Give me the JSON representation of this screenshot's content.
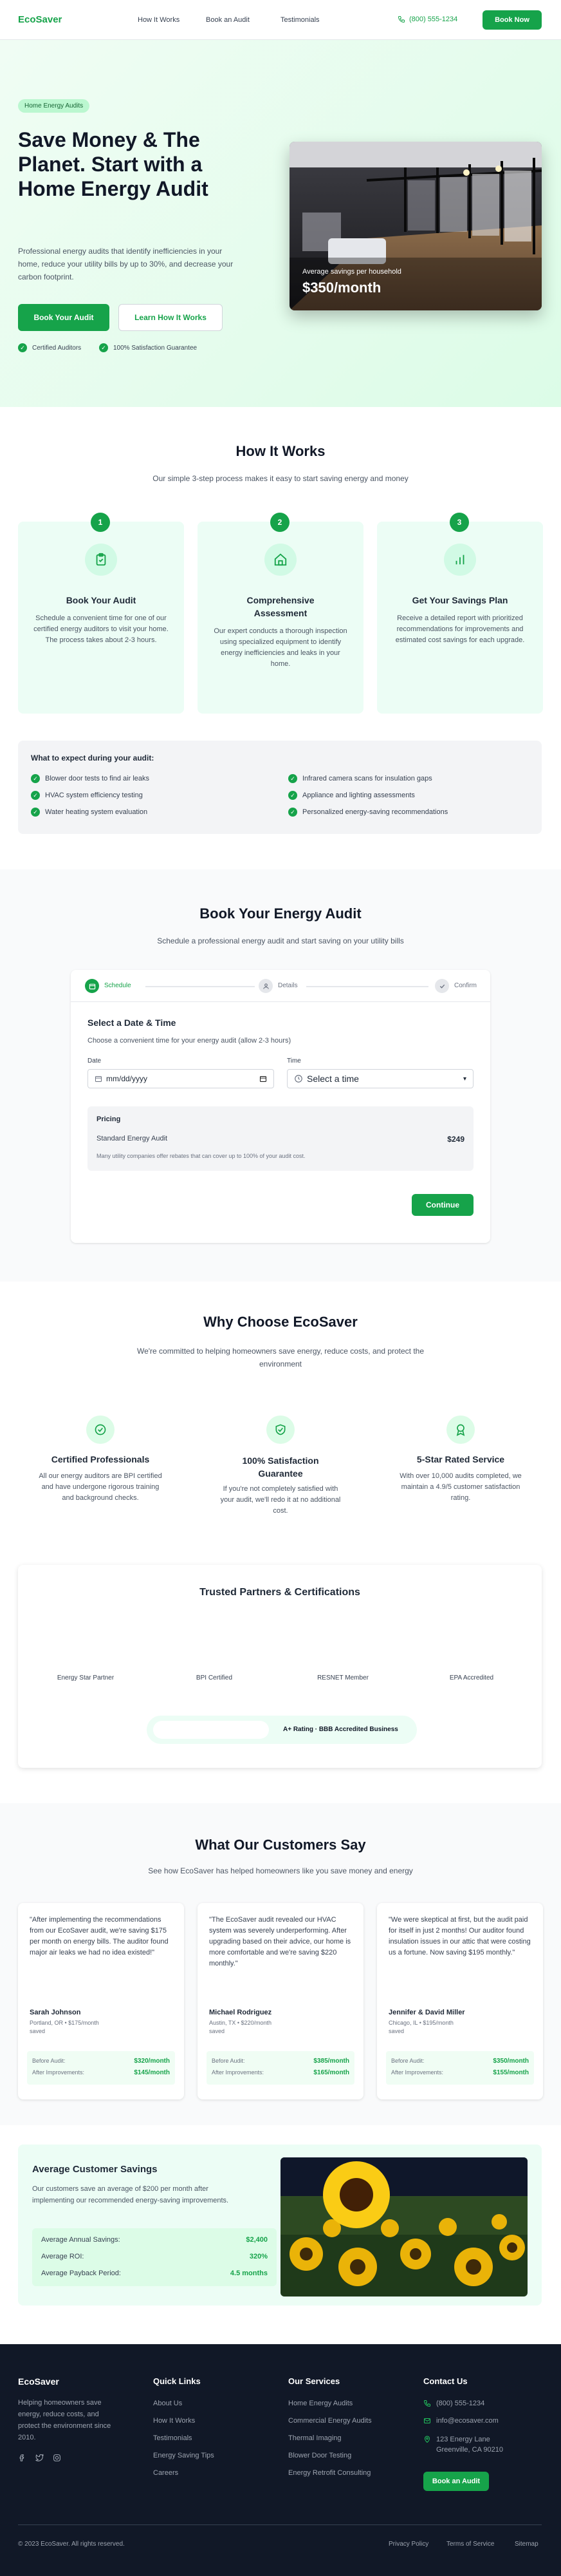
{
  "nav": {
    "logo": "EcoSaver",
    "links": [
      "How It Works",
      "Book an Audit",
      "Testimonials"
    ],
    "phone": "(800) 555-1234",
    "cta": "Book Now"
  },
  "hero": {
    "badge": "Home Energy Audits",
    "title": "Save Money & The Planet. Start with a Home Energy Audit",
    "desc": "Professional energy audits that identify inefficiencies in your home, reduce your utility bills by up to 30%, and decrease your carbon footprint.",
    "btn_primary": "Book Your Audit",
    "btn_secondary": "Learn How It Works",
    "trust": [
      "Certified Auditors",
      "100% Satisfaction Guarantee"
    ],
    "img_caption": "Average savings per household",
    "img_value": "$350/month"
  },
  "how": {
    "title": "How It Works",
    "subtitle": "Our simple 3-step process makes it easy to start saving energy and money",
    "steps": [
      {
        "num": "1",
        "title": "Book Your Audit",
        "desc": "Schedule a convenient time for one of our certified energy auditors to visit your home. The process takes about 2-3 hours.",
        "icon": "clipboard-icon"
      },
      {
        "num": "2",
        "title": "Comprehensive Assessment",
        "desc": "Our expert conducts a thorough inspection using specialized equipment to identify energy inefficiencies and leaks in your home.",
        "icon": "home-icon"
      },
      {
        "num": "3",
        "title": "Get Your Savings Plan",
        "desc": "Receive a detailed report with prioritized recommendations for improvements and estimated cost savings for each upgrade.",
        "icon": "chart-icon"
      }
    ],
    "expect_title": "What to expect during your audit:",
    "expect": [
      "Blower door tests to find air leaks",
      "HVAC system efficiency testing",
      "Water heating system evaluation",
      "Infrared camera scans for insulation gaps",
      "Appliance and lighting assessments",
      "Personalized energy-saving recommendations"
    ]
  },
  "book": {
    "title": "Book Your Energy Audit",
    "subtitle": "Schedule a professional energy audit and start saving on your utility bills",
    "steps": [
      "Schedule",
      "Details",
      "Confirm"
    ],
    "form_title": "Select a Date & Time",
    "form_sub": "Choose a convenient time for your energy audit (allow 2-3 hours)",
    "date_label": "Date",
    "date_placeholder": "mm/dd/yyyy",
    "time_label": "Time",
    "time_value": "Select a time",
    "pricing_title": "Pricing",
    "pricing_item": "Standard Energy Audit",
    "pricing_value": "$249",
    "pricing_note": "Many utility companies offer rebates that can cover up to 100% of your audit cost.",
    "continue": "Continue"
  },
  "why": {
    "title": "Why Choose EcoSaver",
    "subtitle": "We're committed to helping homeowners save energy, reduce costs, and protect the environment",
    "items": [
      {
        "title": "Certified Professionals",
        "desc": "All our energy auditors are BPI certified and have undergone rigorous training and background checks."
      },
      {
        "title": "100% Satisfaction Guarantee",
        "desc": "If you're not completely satisfied with your audit, we'll redo it at no additional cost."
      },
      {
        "title": "5-Star Rated Service",
        "desc": "With over 10,000 audits completed, we maintain a 4.9/5 customer satisfaction rating."
      }
    ],
    "partners_title": "Trusted Partners & Certifications",
    "partners": [
      "Energy Star Partner",
      "BPI Certified",
      "RESNET Member",
      "EPA Accredited"
    ],
    "rating": "A+ Rating · BBB Accredited Business"
  },
  "testimonials": {
    "title": "What Our Customers Say",
    "subtitle": "See how EcoSaver has helped homeowners like you save money and energy",
    "items": [
      {
        "quote": "\"After implementing the recommendations from our EcoSaver audit, we're saving $175 per month on energy bills. The auditor found major air leaks we had no idea existed!\"",
        "name": "Sarah Johnson",
        "loc": "Portland, OR • $175/month saved",
        "before": "$320/month",
        "after": "$145/month"
      },
      {
        "quote": "\"The EcoSaver audit revealed our HVAC system was severely underperforming. After upgrading based on their advice, our home is more comfortable and we're saving $220 monthly.\"",
        "name": "Michael Rodriguez",
        "loc": "Austin, TX • $220/month saved",
        "before": "$385/month",
        "after": "$165/month"
      },
      {
        "quote": "\"We were skeptical at first, but the audit paid for itself in just 2 months! Our auditor found insulation issues in our attic that were costing us a fortune. Now saving $195 monthly.\"",
        "name": "Jennifer & David Miller",
        "loc": "Chicago, IL • $195/month saved",
        "before": "$350/month",
        "after": "$155/month"
      }
    ],
    "before_label": "Before Audit:",
    "after_label": "After Improvements:"
  },
  "savings": {
    "title": "Average Customer Savings",
    "desc": "Our customers save an average of $200 per month after implementing our recommended energy-saving improvements.",
    "rows": [
      {
        "label": "Average Annual Savings:",
        "value": "$2,400"
      },
      {
        "label": "Average ROI:",
        "value": "320%"
      },
      {
        "label": "Average Payback Period:",
        "value": "4.5 months"
      }
    ]
  },
  "footer": {
    "logo": "EcoSaver",
    "desc": "Helping homeowners save energy, reduce costs, and protect the environment since 2010.",
    "quick_title": "Quick Links",
    "quick": [
      "About Us",
      "How It Works",
      "Testimonials",
      "Energy Saving Tips",
      "Careers"
    ],
    "services_title": "Our Services",
    "services": [
      "Home Energy Audits",
      "Commercial Energy Audits",
      "Thermal Imaging",
      "Blower Door Testing",
      "Energy Retrofit Consulting"
    ],
    "contact_title": "Contact Us",
    "phone": "(800) 555-1234",
    "email": "info@ecosaver.com",
    "address1": "123 Energy Lane",
    "address2": "Greenville, CA 90210",
    "cta": "Book an Audit",
    "copyright": "© 2023 EcoSaver. All rights reserved.",
    "legal": [
      "Privacy Policy",
      "Terms of Service",
      "Sitemap"
    ]
  },
  "colors": {
    "accent": "#16a34a",
    "light": "#ecfdf5",
    "dark": "#111827"
  }
}
